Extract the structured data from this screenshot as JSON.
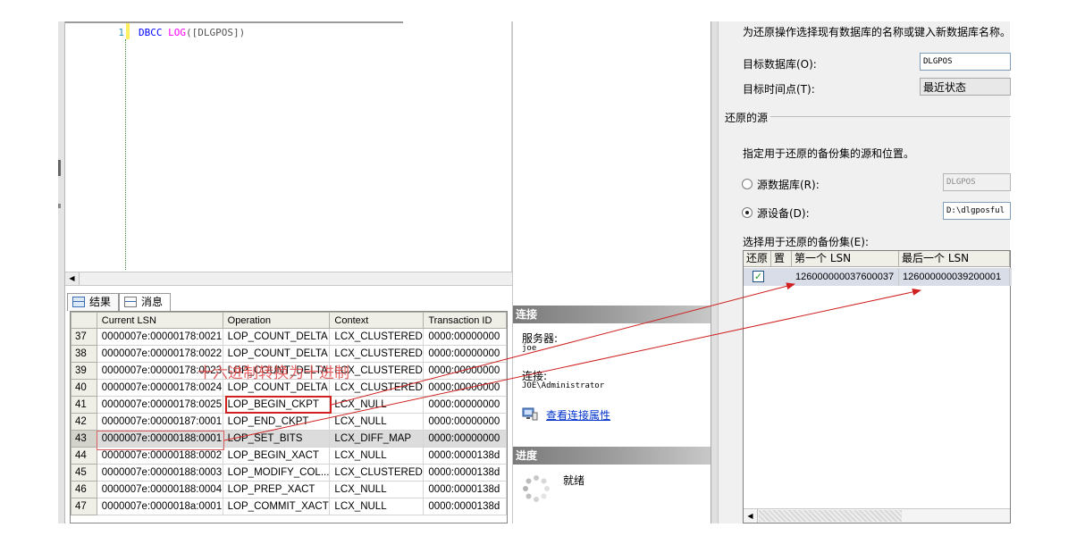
{
  "editor": {
    "line_number": "1",
    "code_keyword": "DBCC",
    "code_function": "LOG",
    "code_args": "([DLGPOS])"
  },
  "results_tabs": {
    "results_label": "结果",
    "messages_label": "消息"
  },
  "results_grid": {
    "columns": [
      "Current LSN",
      "Operation",
      "Context",
      "Transaction ID"
    ],
    "rows": [
      {
        "num": "37",
        "lsn": "0000007e:00000178:0021",
        "op": "LOP_COUNT_DELTA",
        "ctx": "LCX_CLUSTERED",
        "tid": "0000:00000000"
      },
      {
        "num": "38",
        "lsn": "0000007e:00000178:0022",
        "op": "LOP_COUNT_DELTA",
        "ctx": "LCX_CLUSTERED",
        "tid": "0000:00000000"
      },
      {
        "num": "39",
        "lsn": "0000007e:00000178:0023",
        "op": "LOP_COUNT_DELTA",
        "ctx": "LCX_CLUSTERED",
        "tid": "0000:00000000"
      },
      {
        "num": "40",
        "lsn": "0000007e:00000178:0024",
        "op": "LOP_COUNT_DELTA",
        "ctx": "LCX_CLUSTERED",
        "tid": "0000:00000000"
      },
      {
        "num": "41",
        "lsn": "0000007e:00000178:0025",
        "op": "LOP_BEGIN_CKPT",
        "ctx": "LCX_NULL",
        "tid": "0000:00000000"
      },
      {
        "num": "42",
        "lsn": "0000007e:00000187:0001",
        "op": "LOP_END_CKPT",
        "ctx": "LCX_NULL",
        "tid": "0000:00000000"
      },
      {
        "num": "43",
        "lsn": "0000007e:00000188:0001",
        "op": "LOP_SET_BITS",
        "ctx": "LCX_DIFF_MAP",
        "tid": "0000:00000000"
      },
      {
        "num": "44",
        "lsn": "0000007e:00000188:0002",
        "op": "LOP_BEGIN_XACT",
        "ctx": "LCX_NULL",
        "tid": "0000:0000138d"
      },
      {
        "num": "45",
        "lsn": "0000007e:00000188:0003",
        "op": "LOP_MODIFY_COL...",
        "ctx": "LCX_CLUSTERED",
        "tid": "0000:0000138d"
      },
      {
        "num": "46",
        "lsn": "0000007e:00000188:0004",
        "op": "LOP_PREP_XACT",
        "ctx": "LCX_NULL",
        "tid": "0000:0000138d"
      },
      {
        "num": "47",
        "lsn": "0000007e:0000018a:0001",
        "op": "LOP_COMMIT_XACT",
        "ctx": "LCX_NULL",
        "tid": "0000:0000138d"
      }
    ]
  },
  "annotation": {
    "text": "十六进制转换为十进制",
    "color": "#d02020"
  },
  "connection_panel": {
    "connection_header": "连接",
    "server_label": "服务器:",
    "server_value": "joe",
    "connection_label": "连接:",
    "connection_value": "JOE\\Administrator",
    "view_properties_link": "查看连接属性",
    "progress_header": "进度",
    "progress_status": "就绪"
  },
  "restore_dialog": {
    "intro_text": "为还原操作选择现有数据库的名称或键入新数据库名称。",
    "target_db_label": "目标数据库(O):",
    "target_db_value": "DLGPOS",
    "target_time_label": "目标时间点(T):",
    "target_time_value": "最近状态",
    "source_group_label": "还原的源",
    "source_intro_text": "指定用于还原的备份集的源和位置。",
    "source_db_label": "源数据库(R):",
    "source_db_value": "DLGPOS",
    "source_device_label": "源设备(D):",
    "source_device_value": "D:\\dlgposful",
    "backup_sets_label": "选择用于还原的备份集(E):",
    "backup_grid": {
      "col_restore": "还原",
      "col_position": "置",
      "col_first_lsn": "第一个 LSN",
      "col_last_lsn": "最后一个 LSN",
      "row_first_lsn": "126000000037600037",
      "row_last_lsn": "126000000039200001"
    }
  }
}
